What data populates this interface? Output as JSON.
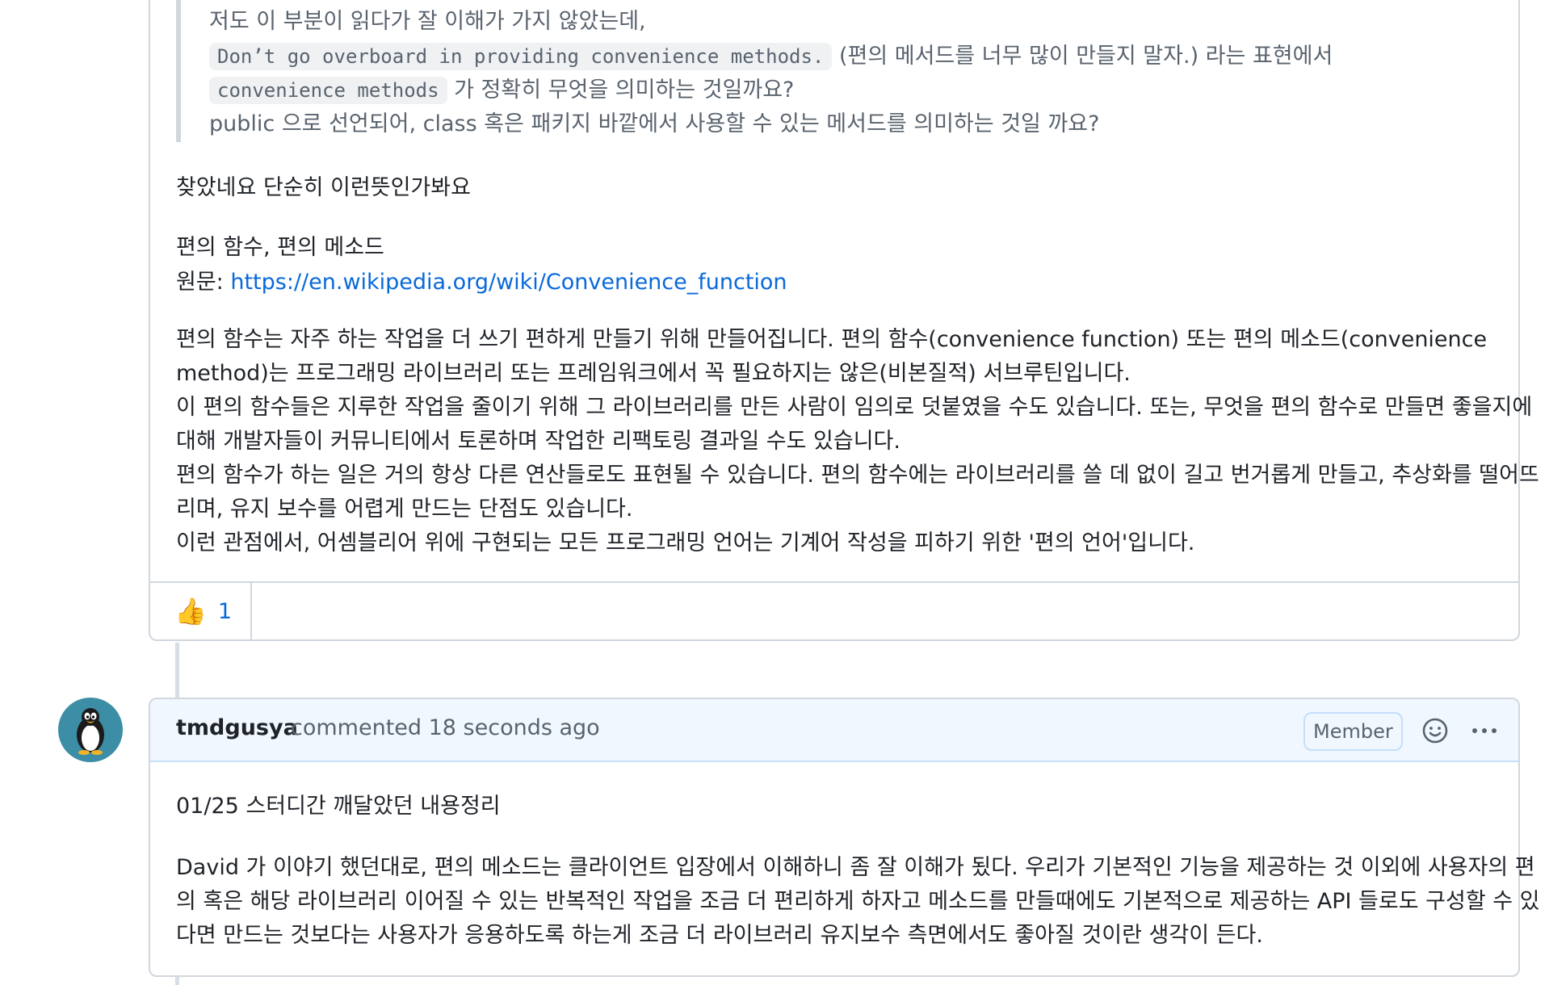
{
  "first_comment": {
    "quote": {
      "line1": "저도 이 부분이 읽다가 잘 이해가 가지 않았는데,",
      "line2_code": "Don’t go overboard in providing convenience methods.",
      "line2_text": " (편의 메서드를 너무 많이 만들지 말자.) 라는 표현에서",
      "line3_code": "convenience methods",
      "line3_text": " 가 정확히 무엇을 의미하는 것일까요?",
      "line4": "public 으로 선언되어, class 혹은 패키지 바깥에서 사용할 수 있는 메서드를 의미하는 것일 까요?"
    },
    "found_text": "찾았네요 단순히 이런뜻인가봐요",
    "term_text": "편의 함수, 편의 메소드",
    "source_label": "원문: ",
    "source_link": "https://en.wikipedia.org/wiki/Convenience_function",
    "paragraph": [
      "편의 함수는 자주 하는 작업을 더 쓰기 편하게 만들기 위해 만들어집니다. 편의 함수(convenience function) 또는 편의 메소드(convenience",
      "method)는 프로그래밍 라이브러리 또는 프레임워크에서 꼭 필요하지는 않은(비본질적) 서브루틴입니다.",
      "이 편의 함수들은 지루한 작업을 줄이기 위해 그 라이브러리를 만든 사람이 임의로 덧붙였을 수도 있습니다. 또는, 무엇을 편의 함수로 만들면 좋을지에",
      "대해 개발자들이 커뮤니티에서 토론하며 작업한 리팩토링 결과일 수도 있습니다.",
      "편의 함수가 하는 일은 거의 항상 다른 연산들로도 표현될 수 있습니다. 편의 함수에는 라이브러리를 쓸 데 없이 길고 번거롭게 만들고, 추상화를 떨어뜨",
      "리며, 유지 보수를 어렵게 만드는 단점도 있습니다.",
      "이런 관점에서, 어셈블리어 위에 구현되는 모든 프로그래밍 언어는 기계어 작성을 피하기 위한 '편의 언어'입니다."
    ],
    "reaction": {
      "emoji": "👍",
      "count": "1"
    }
  },
  "second_comment": {
    "author": "tmdgusya",
    "meta": "commented 18 seconds ago",
    "badge": "Member",
    "title": "01/25 스터디간 깨달았던 내용정리",
    "body": [
      "David 가 이야기 했던대로, 편의 메소드는 클라이언트 입장에서 이해하니 좀 잘 이해가 됬다. 우리가 기본적인 기능을 제공하는 것 이외에 사용자의 편",
      "의 혹은 해당 라이브러리 이어질 수 있는 반복적인 작업을 조금 더 편리하게 하자고 메소드를 만들때에도 기본적으로 제공하는 API 들로도 구성할 수 있",
      "다면 만드는 것보다는 사용자가 응용하도록 하는게 조금 더 라이브러리 유지보수 측면에서도 좋아질 것이란 생각이 든다."
    ]
  },
  "colors": {
    "link": "#0969da",
    "border": "#d0d7de",
    "header_bg": "#f0f7ff",
    "avatar_bg": "#3b8ea5"
  }
}
